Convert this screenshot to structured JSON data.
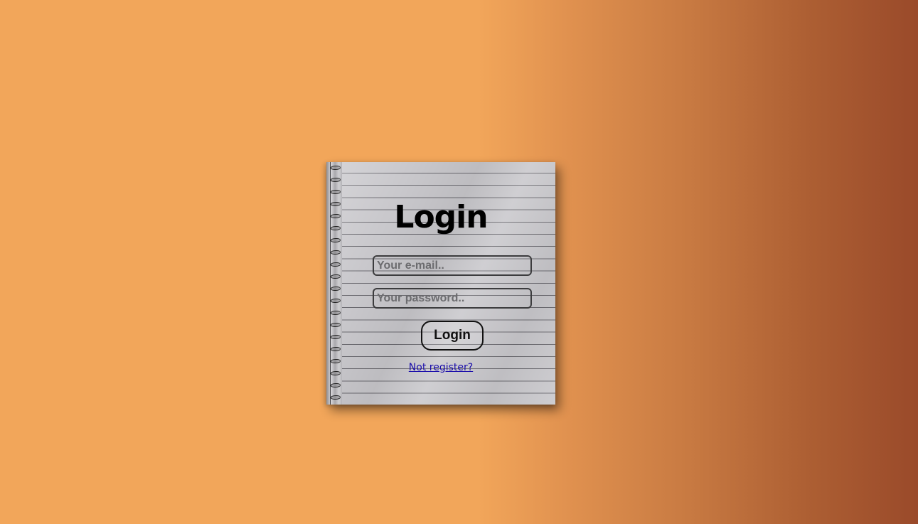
{
  "login_card": {
    "title": "Login",
    "email_placeholder": "Your e-mail..",
    "password_placeholder": "Your password..",
    "submit_label": "Login",
    "register_link_text": "Not register?"
  },
  "colors": {
    "background_start": "#f2a65a",
    "background_end": "#9a4a2a",
    "link": "#1a0dab"
  },
  "icons": {
    "spiral_binding": "spiral-binding-icon"
  }
}
